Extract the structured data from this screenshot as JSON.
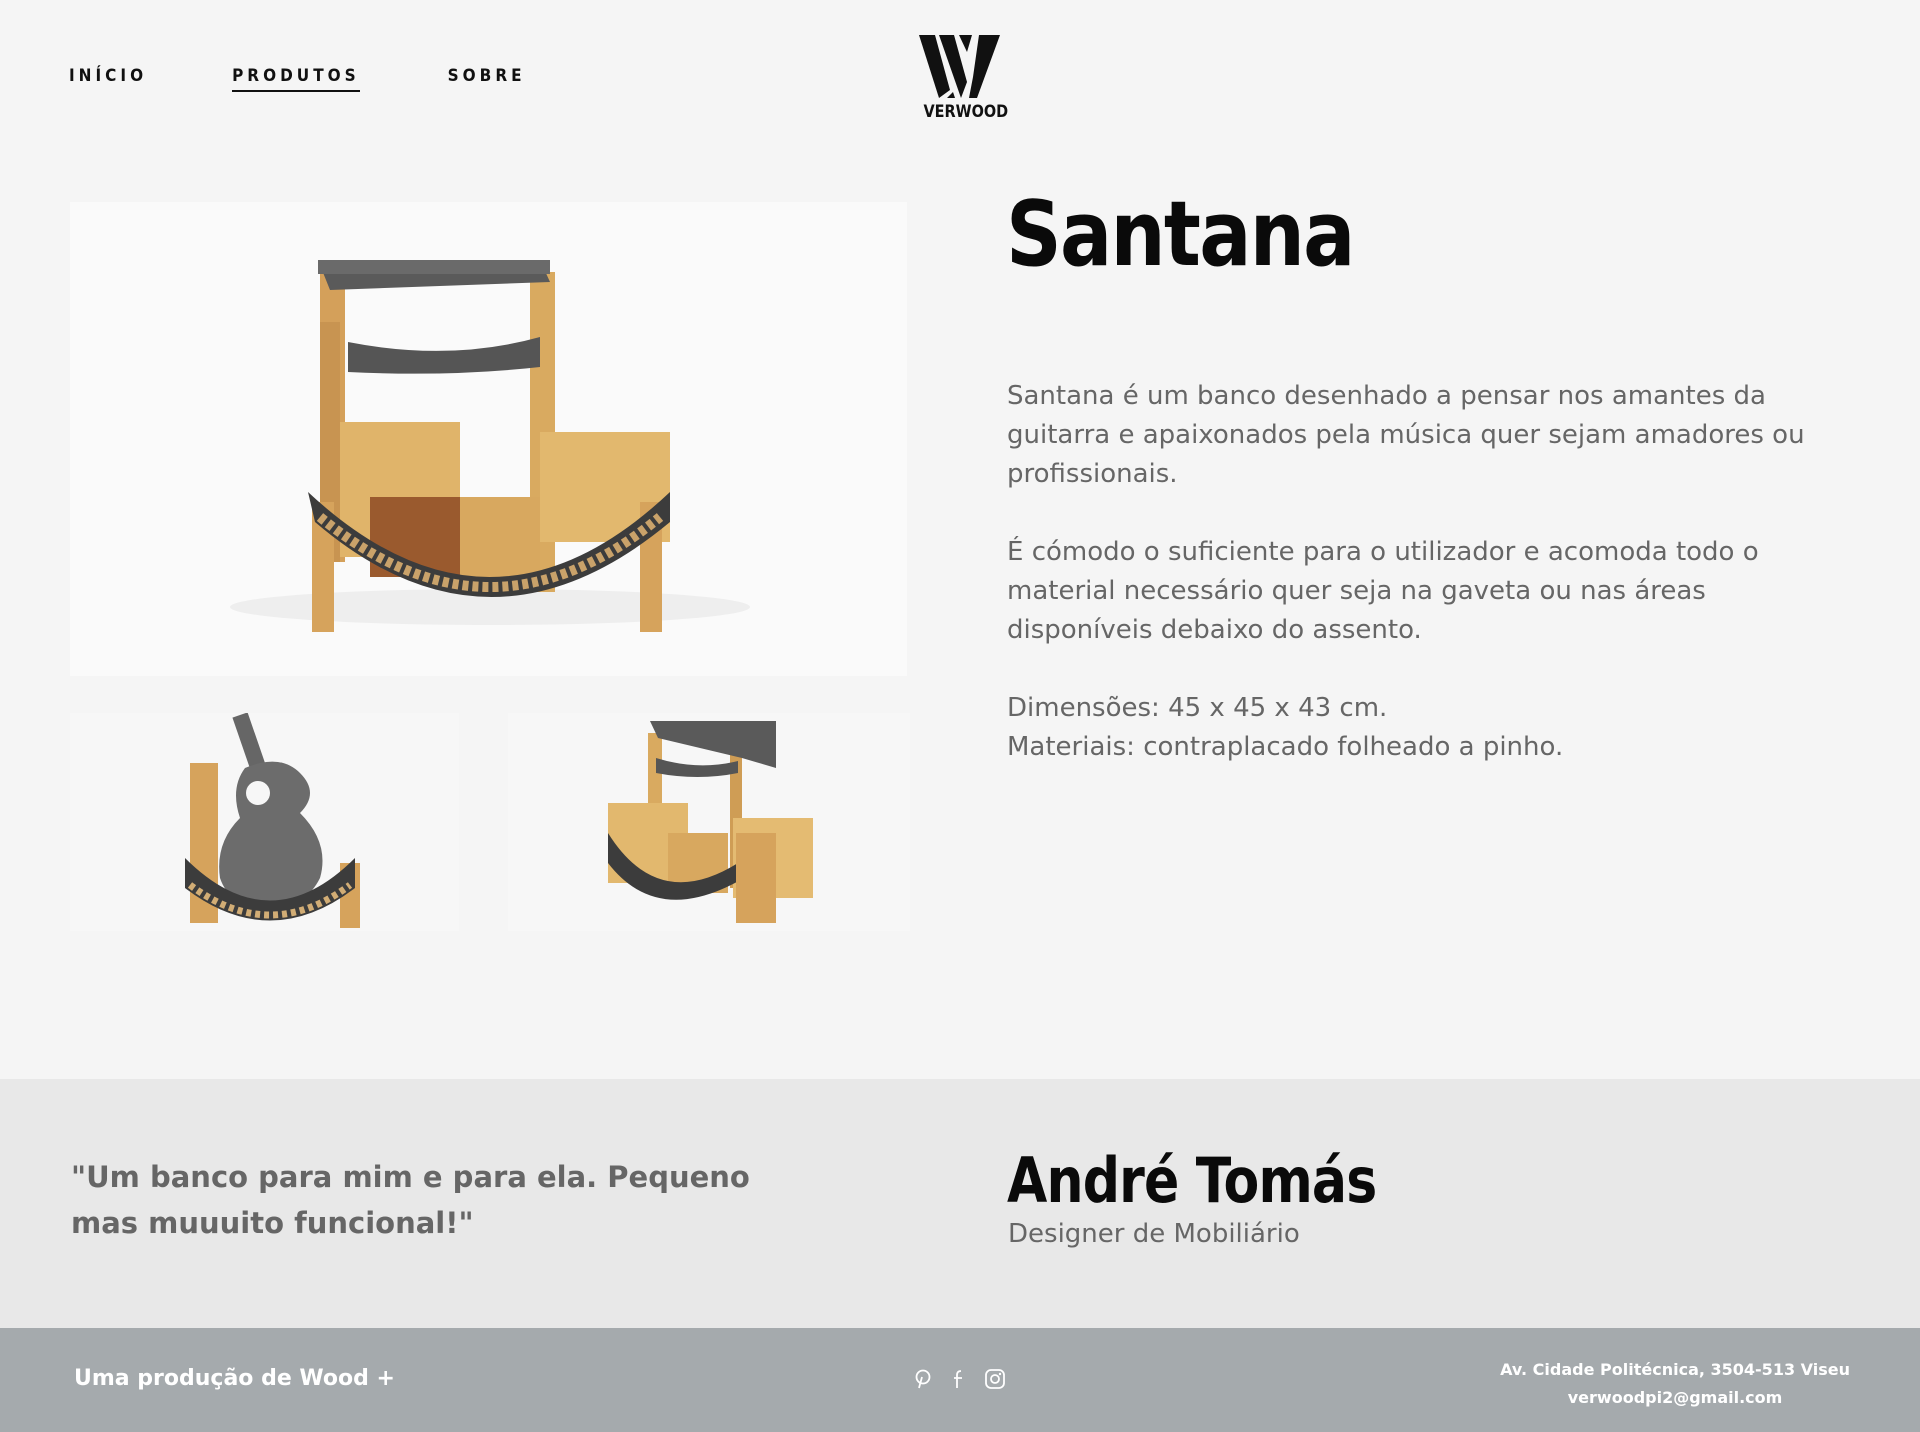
{
  "nav": {
    "items": [
      {
        "label": "INÍCIO"
      },
      {
        "label": "PRODUTOS",
        "active": true
      },
      {
        "label": "SOBRE"
      }
    ]
  },
  "brand": {
    "name": "VERWOOD"
  },
  "product": {
    "title": "Santana",
    "paragraphs": [
      "Santana é um banco desenhado a pensar nos amantes da guitarra e apaixonados pela música quer sejam amadores ou profissionais.",
      "É cómodo o suficiente para o utilizador e acomoda todo o material necessário quer seja na gaveta ou nas áreas disponíveis debaixo do assento."
    ],
    "dimensions": "Dimensões: 45 x 45 x 43 cm.",
    "materials": "Materiais: contraplacado folheado a pinho."
  },
  "testimonial": {
    "quote": "\"Um banco para mim e para ela. Pequeno mas muuuito funcional!\"",
    "person": "André Tomás",
    "role": "Designer de Mobiliário"
  },
  "footer": {
    "credit": "Uma produção de Wood +",
    "address": "Av. Cidade Politécnica, 3504-513 Viseu",
    "email": "verwoodpi2@gmail.com",
    "social_icons": [
      "pinterest-icon",
      "facebook-icon",
      "instagram-icon"
    ]
  },
  "colors": {
    "background": "#f5f5f5",
    "band": "#e8e8e8",
    "footer": "#a5aaad",
    "wood": "#d9a95a",
    "felt": "#555555"
  }
}
